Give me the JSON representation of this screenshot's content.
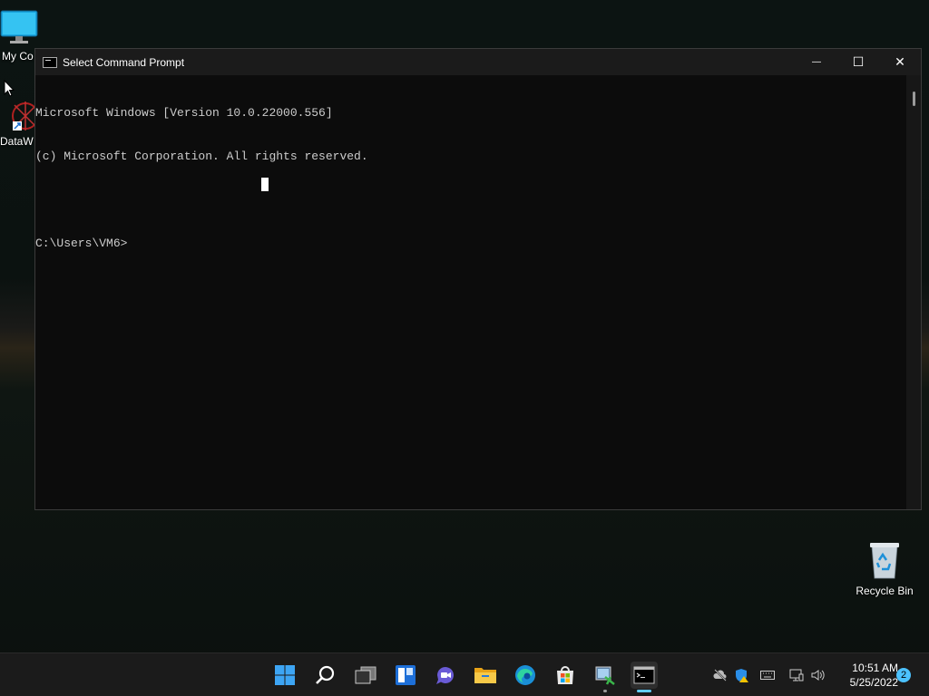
{
  "desktop": {
    "icons": [
      {
        "label": "My Co"
      },
      {
        "label": "DataW"
      },
      {
        "label": "Recycle Bin"
      }
    ]
  },
  "window": {
    "title": "Select Command Prompt",
    "minimize_glyph": "—",
    "maximize_glyph": "☐",
    "close_glyph": "✕",
    "console_lines": [
      "Microsoft Windows [Version 10.0.22000.556]",
      "(c) Microsoft Corporation. All rights reserved.",
      "",
      "C:\\Users\\VM6>"
    ]
  },
  "taskbar": {
    "apps": [
      {
        "icon": "start-icon"
      },
      {
        "icon": "search-icon"
      },
      {
        "icon": "task-view-icon"
      },
      {
        "icon": "widgets-icon"
      },
      {
        "icon": "teams-chat-icon"
      },
      {
        "icon": "file-explorer-icon"
      },
      {
        "icon": "edge-icon"
      },
      {
        "icon": "store-icon"
      },
      {
        "icon": "network-tool-icon"
      },
      {
        "icon": "command-prompt-icon"
      }
    ],
    "clock": {
      "time": "10:51 AM",
      "date": "5/25/2022"
    },
    "notification_count": "2"
  },
  "colors": {
    "accent": "#60cdff",
    "console_bg": "#0c0c0c",
    "console_text": "#cccccc"
  }
}
